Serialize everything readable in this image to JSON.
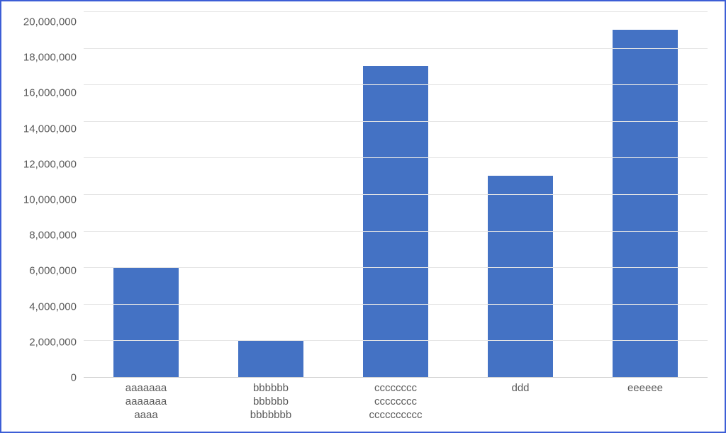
{
  "chart_data": {
    "type": "bar",
    "title": "",
    "xlabel": "",
    "ylabel": "",
    "ylim": [
      0,
      20000000
    ],
    "y_ticks": [
      0,
      2000000,
      4000000,
      6000000,
      8000000,
      10000000,
      12000000,
      14000000,
      16000000,
      18000000,
      20000000
    ],
    "y_tick_labels": [
      "0",
      "2,000,000",
      "4,000,000",
      "6,000,000",
      "8,000,000",
      "10,000,000",
      "12,000,000",
      "14,000,000",
      "16,000,000",
      "18,000,000",
      "20,000,000"
    ],
    "categories": [
      "aaaaaaa aaaaaaa aaaa",
      "bbbbbb bbbbbb bbbbbbb",
      "cccccccc cccccccc cccccccccc",
      "ddd",
      "eeeeee"
    ],
    "category_label_lines": [
      [
        "aaaaaaa",
        "aaaaaaa",
        "aaaa"
      ],
      [
        "bbbbbb",
        "bbbbbb",
        "bbbbbbb"
      ],
      [
        "cccccccc",
        "cccccccc",
        "cccccccccc"
      ],
      [
        "ddd"
      ],
      [
        "eeeeee"
      ]
    ],
    "values": [
      6000000,
      2000000,
      17000000,
      11000000,
      19000000
    ],
    "bar_color": "#4472c4",
    "frame_color": "#3c5ed6",
    "grid": true
  }
}
